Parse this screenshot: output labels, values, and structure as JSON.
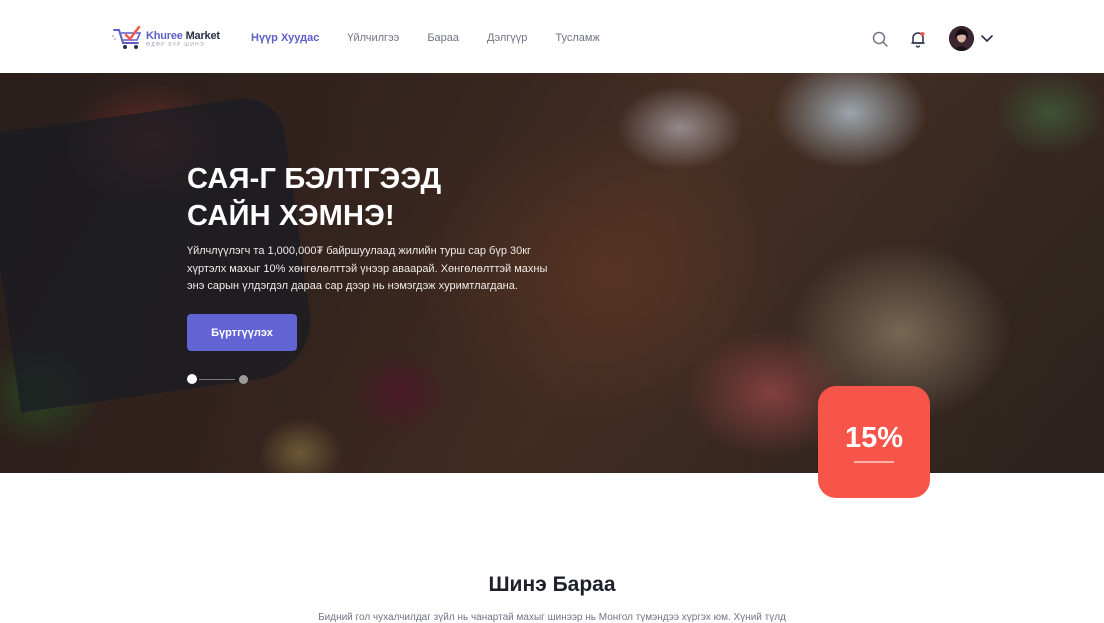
{
  "header": {
    "logo": {
      "brand_a": "Khuree ",
      "brand_b": "Market",
      "tagline": "ӨДӨР БҮР ШИНЭ"
    },
    "nav": [
      {
        "label": "Нүүр Хуудас",
        "active": true
      },
      {
        "label": "Үйлчилгээ",
        "active": false
      },
      {
        "label": "Бараа",
        "active": false
      },
      {
        "label": "Дэлгүүр",
        "active": false
      },
      {
        "label": "Тусламж",
        "active": false
      }
    ],
    "icons": [
      "search-icon",
      "bell-icon",
      "avatar",
      "chevron-down-icon"
    ]
  },
  "hero": {
    "title_line1": "САЯ-Г БЭЛТГЭЭД",
    "title_line2": "САЙН ХЭМНЭ!",
    "description": "Үйлчлүүлэгч та 1,000,000₮ байршуулаад жилийн турш сар бүр 30кг хүртэлх махыг 10% хөнгөлөлттэй үнээр аваарай. Хөнгөлөлттэй махны энэ сарын үлдэгдэл дараа сар дээр нь нэмэгдэж хуримтлагдана.",
    "cta_label": "Бүртгүүлэх",
    "slides": {
      "count": 2,
      "active": 1
    },
    "badge": "15%"
  },
  "new_products": {
    "title": "Шинэ Бараа",
    "description": "Бидний гол чухалчилдаг зүйл нь чанартай махыг шинээр нь Монгол түмэндээ хүргэх юм. Хүний түлд"
  },
  "colors": {
    "accent": "#6264d4",
    "badge": "#f7544a",
    "nav_active": "#5b5fc7"
  }
}
